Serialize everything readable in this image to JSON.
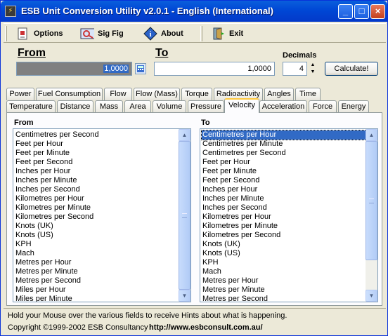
{
  "window": {
    "title": "ESB Unit Conversion Utility v2.0.1 - English (International)",
    "buttons": {
      "minimize": "_",
      "maximize": "□",
      "close": "×"
    }
  },
  "toolbar": {
    "options": "Options",
    "sig_fig": "Sig Fig",
    "about": "About",
    "exit": "Exit"
  },
  "from": {
    "label": "From",
    "value": "1,0000"
  },
  "to": {
    "label": "To",
    "value": "1,0000"
  },
  "decimals": {
    "label": "Decimals",
    "value": "4"
  },
  "calculate_label": "Calculate!",
  "tabs_row1": [
    "Power",
    "Fuel Consumption",
    "Flow",
    "Flow (Mass)",
    "Torque",
    "Radioactivity",
    "Angles",
    "Time"
  ],
  "tabs_row2": [
    "Temperature",
    "Distance",
    "Mass",
    "Area",
    "Volume",
    "Pressure",
    "Velocity",
    "Acceleration",
    "Force",
    "Energy"
  ],
  "active_tab": "Velocity",
  "from_list": {
    "title": "From",
    "items": [
      "Centimetres per Second",
      "Feet per Hour",
      "Feet per Minute",
      "Feet per Second",
      "Inches per Hour",
      "Inches per Minute",
      "Inches per Second",
      "Kilometres per Hour",
      "Kilometres per Minute",
      "Kilometres per Second",
      "Knots (UK)",
      "Knots (US)",
      "KPH",
      "Mach",
      "Metres per Hour",
      "Metres per Minute",
      "Metres per Second",
      "Miles per Hour",
      "Miles per Minute"
    ]
  },
  "to_list": {
    "title": "To",
    "selected": "Centimetres per Hour",
    "items": [
      "Centimetres per Hour",
      "Centimetres per Minute",
      "Centimetres per Second",
      "Feet per Hour",
      "Feet per Minute",
      "Feet per Second",
      "Inches per Hour",
      "Inches per Minute",
      "Inches per Second",
      "Kilometres per Hour",
      "Kilometres per Minute",
      "Kilometres per Second",
      "Knots (UK)",
      "Knots (US)",
      "KPH",
      "Mach",
      "Metres per Hour",
      "Metres per Minute",
      "Metres per Second"
    ]
  },
  "status": {
    "hint": "Hold your Mouse over the various fields to receive Hints about what is happening.",
    "copyright": "Copyright ©1999-2002 ESB Consultancy",
    "url": "http://www.esbconsult.com.au/"
  }
}
